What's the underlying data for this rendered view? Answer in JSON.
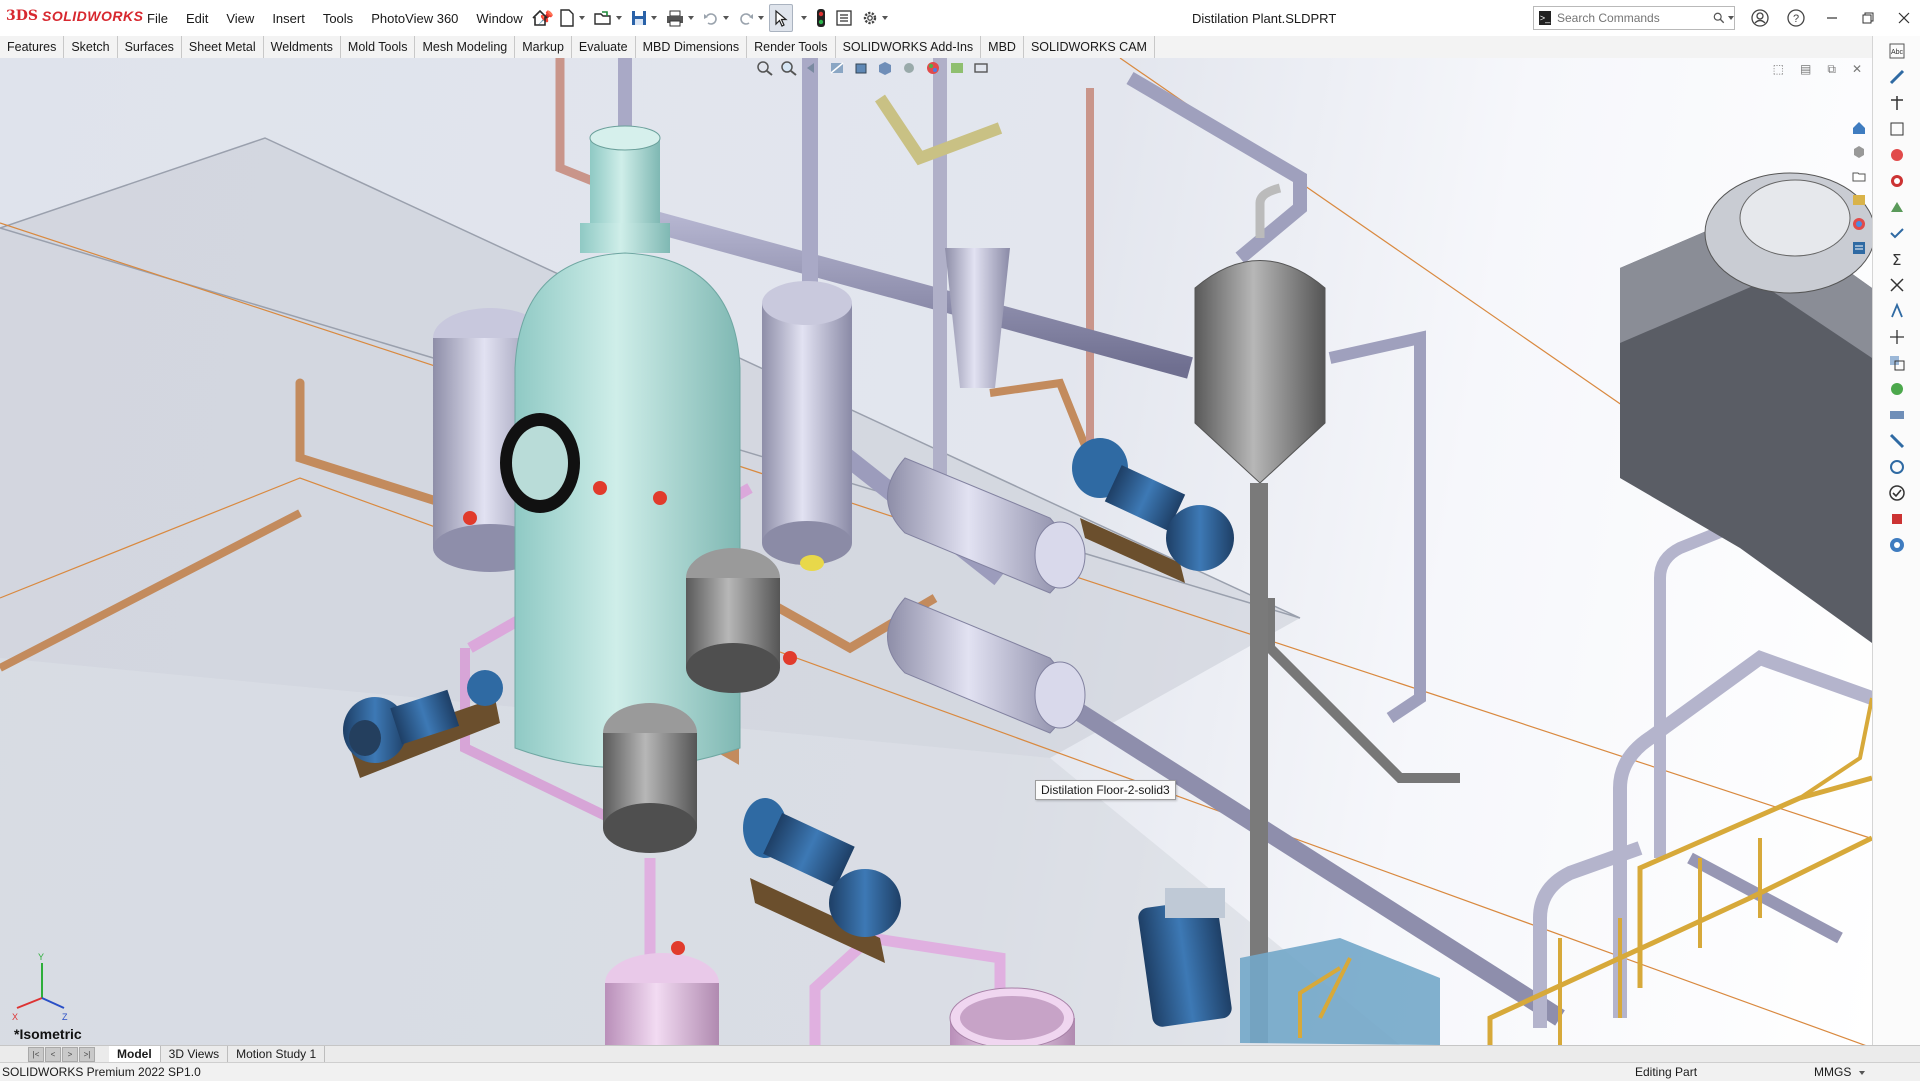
{
  "app": {
    "brand_prefix": "3DS",
    "brand": "SOLIDWORKS"
  },
  "menu": [
    "File",
    "Edit",
    "View",
    "Insert",
    "Tools",
    "PhotoView 360",
    "Window"
  ],
  "document": {
    "title": "Distilation Plant.SLDPRT"
  },
  "search": {
    "placeholder": "Search Commands"
  },
  "tabs": [
    "Features",
    "Sketch",
    "Surfaces",
    "Sheet Metal",
    "Weldments",
    "Mold Tools",
    "Mesh Modeling",
    "Markup",
    "Evaluate",
    "MBD Dimensions",
    "Render Tools",
    "SOLIDWORKS Add-Ins",
    "MBD",
    "SOLIDWORKS CAM"
  ],
  "active_tab": "",
  "viewport": {
    "tooltip": "Distilation Floor-2-solid3",
    "view_label": "*Isometric",
    "triad": {
      "x": "X",
      "y": "Y",
      "z": "Z"
    }
  },
  "bottom_tabs": [
    "Model",
    "3D Views",
    "Motion Study 1"
  ],
  "status": {
    "version": "SOLIDWORKS Premium 2022 SP1.0",
    "mode": "Editing Part",
    "units": "MMGS"
  },
  "colors": {
    "brand": "#d7282f",
    "selected": "#dfe4ec",
    "viewport_bg": "#e3e6ee"
  }
}
